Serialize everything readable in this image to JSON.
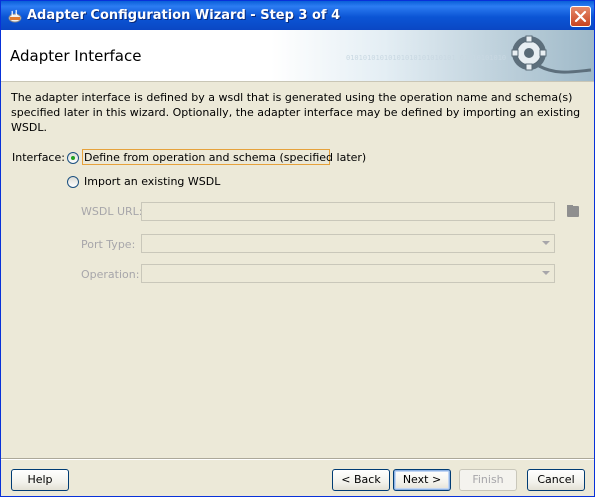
{
  "window": {
    "title": "Adapter Configuration Wizard - Step 3 of 4"
  },
  "header": {
    "title": "Adapter Interface",
    "banner_text": "01010101010101010101010101 01010101010"
  },
  "description": "The adapter interface is defined by a wsdl that is generated using the operation name and schema(s) specified later in this wizard.  Optionally, the adapter interface may be defined by importing an existing WSDL.",
  "interface": {
    "label": "Interface:",
    "options": [
      {
        "label": "Define from operation and schema (specified later)",
        "selected": true
      },
      {
        "label": "Import an existing WSDL",
        "selected": false
      }
    ]
  },
  "fields": {
    "wsdl_url": {
      "label": "WSDL URL:",
      "value": "",
      "enabled": false
    },
    "port_type": {
      "label": "Port Type:",
      "value": "",
      "enabled": false
    },
    "operation": {
      "label": "Operation:",
      "value": "",
      "enabled": false
    }
  },
  "buttons": {
    "help": "Help",
    "back": "< Back",
    "next": "Next >",
    "finish": "Finish",
    "cancel": "Cancel"
  },
  "colors": {
    "titlebar": "#0a55d5",
    "dialog_bg": "#ece9d8",
    "focus": "#e6a23c",
    "radio_selected": "#21a121"
  }
}
